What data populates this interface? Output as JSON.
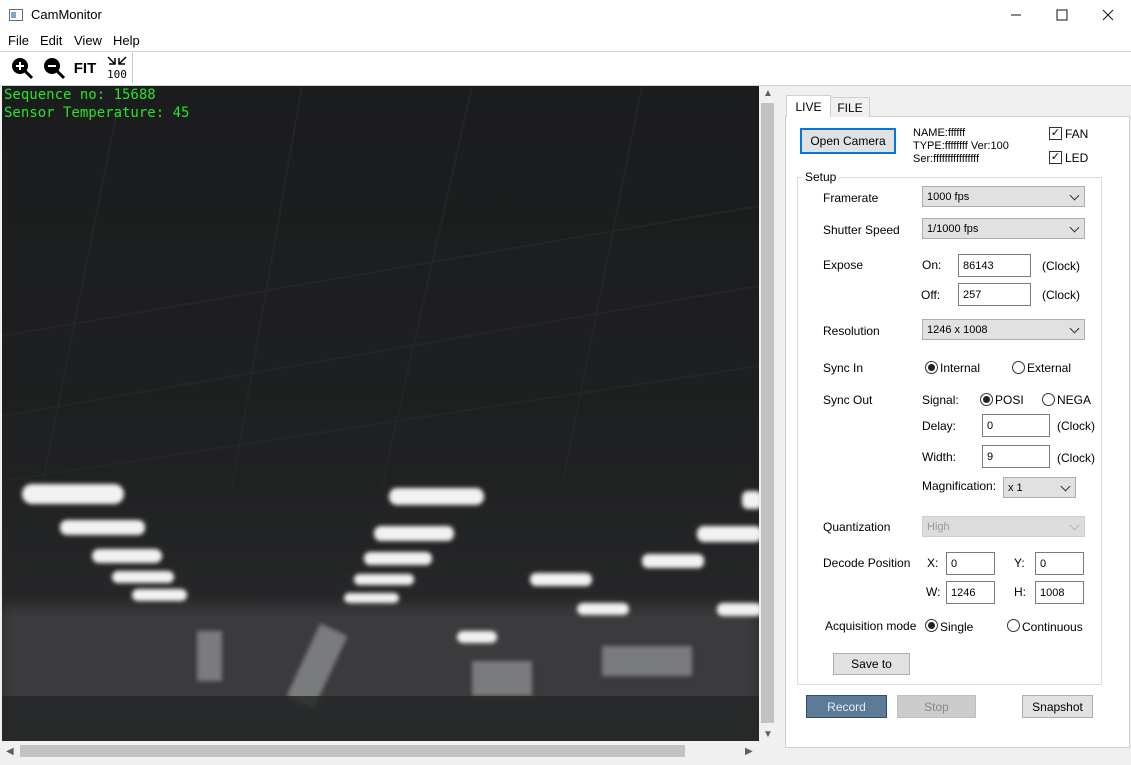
{
  "window": {
    "title": "CamMonitor",
    "minimize": "—",
    "maximize": "☐",
    "close": "✕"
  },
  "menu": [
    "File",
    "Edit",
    "View",
    "Help"
  ],
  "toolbar": {
    "fit_label": "FIT",
    "actual_label": "100"
  },
  "overlay": {
    "sequence": "Sequence no: 15688",
    "temperature": "Sensor Temperature: 45"
  },
  "tabs": [
    "LIVE",
    "FILE"
  ],
  "camera": {
    "open_label": "Open Camera",
    "name": "NAME:ffffff",
    "type": "TYPE:ffffffff Ver:100",
    "serial": "Ser:ffffffffffffffff",
    "fan_label": "FAN",
    "fan_checked": true,
    "led_label": "LED",
    "led_checked": true
  },
  "setup": {
    "title": "Setup",
    "framerate_label": "Framerate",
    "framerate_value": "1000 fps",
    "shutter_label": "Shutter Speed",
    "shutter_value": "1/1000 fps",
    "expose_label": "Expose",
    "on_label": "On:",
    "on_value": "86143",
    "off_label": "Off:",
    "off_value": "257",
    "clock_unit": "(Clock)",
    "resolution_label": "Resolution",
    "resolution_value": "1246 x 1008",
    "syncin_label": "Sync In",
    "syncin_internal": "Internal",
    "syncin_external": "External",
    "syncin_selected": "Internal",
    "syncout_label": "Sync Out",
    "signal_label": "Signal:",
    "signal_posi": "POSI",
    "signal_nega": "NEGA",
    "signal_selected": "POSI",
    "delay_label": "Delay:",
    "delay_value": "0",
    "width_label": "Width:",
    "width_value": "9",
    "magnification_label": "Magnification:",
    "magnification_value": "x 1",
    "quantization_label": "Quantization",
    "quantization_value": "High",
    "decode_label": "Decode Position",
    "x_label": "X:",
    "x_value": "0",
    "y_label": "Y:",
    "y_value": "0",
    "w_label": "W:",
    "w_value": "1246",
    "h_label": "H:",
    "h_value": "1008",
    "acq_label": "Acquisition mode",
    "acq_single": "Single",
    "acq_continuous": "Continuous",
    "acq_selected": "Single",
    "save_label": "Save to"
  },
  "actions": {
    "record": "Record",
    "stop": "Stop",
    "snapshot": "Snapshot"
  }
}
